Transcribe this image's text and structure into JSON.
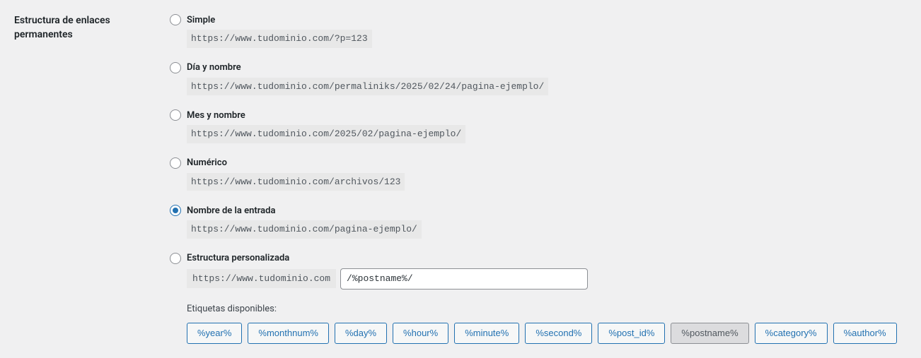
{
  "section_title": "Estructura de enlaces permanentes",
  "options": [
    {
      "label": "Simple",
      "example": "https://www.tudominio.com/?p=123",
      "checked": false
    },
    {
      "label": "Día y nombre",
      "example": "https://www.tudominio.com/permaliniks/2025/02/24/pagina-ejemplo/",
      "checked": false
    },
    {
      "label": "Mes y nombre",
      "example": "https://www.tudominio.com/2025/02/pagina-ejemplo/",
      "checked": false
    },
    {
      "label": "Numérico",
      "example": "https://www.tudominio.com/archivos/123",
      "checked": false
    },
    {
      "label": "Nombre de la entrada",
      "example": "https://www.tudominio.com/pagina-ejemplo/",
      "checked": true
    }
  ],
  "custom": {
    "label": "Estructura personalizada",
    "base_url": "https://www.tudominio.com",
    "value": "/%postname%/",
    "checked": false
  },
  "tags_label": "Etiquetas disponibles:",
  "tags": [
    {
      "text": "%year%",
      "active": false
    },
    {
      "text": "%monthnum%",
      "active": false
    },
    {
      "text": "%day%",
      "active": false
    },
    {
      "text": "%hour%",
      "active": false
    },
    {
      "text": "%minute%",
      "active": false
    },
    {
      "text": "%second%",
      "active": false
    },
    {
      "text": "%post_id%",
      "active": false
    },
    {
      "text": "%postname%",
      "active": true
    },
    {
      "text": "%category%",
      "active": false
    },
    {
      "text": "%author%",
      "active": false
    }
  ]
}
